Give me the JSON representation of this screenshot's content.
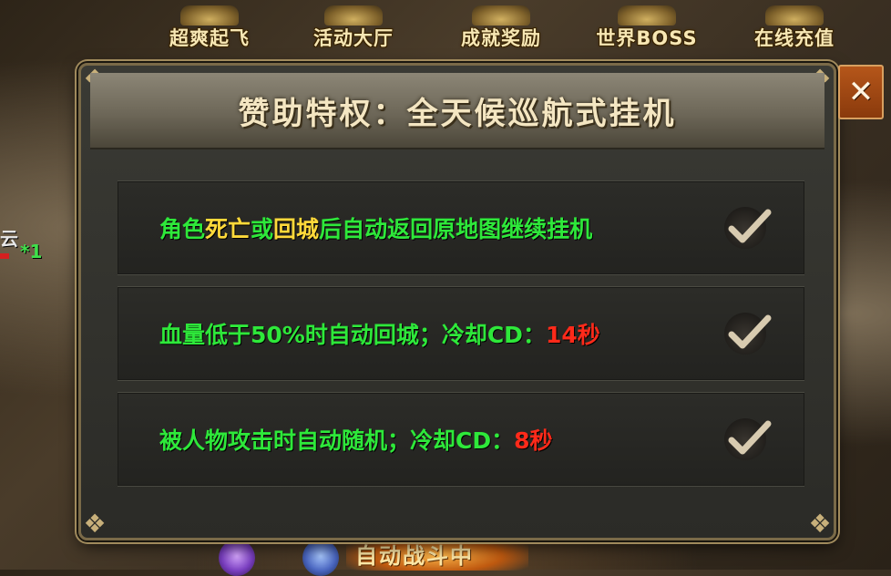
{
  "top_menu": [
    {
      "label": "超爽起飞",
      "icon": "rocket-icon"
    },
    {
      "label": "活动大厅",
      "icon": "hall-icon"
    },
    {
      "label": "成就奖励",
      "icon": "trophy-icon"
    },
    {
      "label": "世界BOSS",
      "icon": "boss-icon"
    },
    {
      "label": "在线充值",
      "icon": "gold-icon"
    }
  ],
  "side": {
    "text": "云",
    "count": "*1"
  },
  "dialog": {
    "title": "赞助特权：全天候巡航式挂机",
    "close_label": "✕",
    "rows": [
      {
        "parts": [
          {
            "text": "角色",
            "color": "green"
          },
          {
            "text": "死亡",
            "color": "yellow"
          },
          {
            "text": "或",
            "color": "green"
          },
          {
            "text": "回城",
            "color": "yellow"
          },
          {
            "text": "后自动返回原地图继续挂机",
            "color": "green"
          }
        ],
        "checked": true
      },
      {
        "parts": [
          {
            "text": "血量低于50%时自动回城；冷却CD：",
            "color": "green"
          },
          {
            "text": "14秒",
            "color": "red"
          }
        ],
        "checked": true
      },
      {
        "parts": [
          {
            "text": "被人物攻击时自动随机；冷却CD：",
            "color": "green"
          },
          {
            "text": "8秒",
            "color": "red"
          }
        ],
        "checked": true
      }
    ]
  },
  "bottom_hud": {
    "text": "自动战斗中"
  },
  "colors": {
    "green": "#2ee83a",
    "yellow": "#ffd93a",
    "red": "#ff2a1a",
    "gold_text": "#f4e6c2"
  }
}
